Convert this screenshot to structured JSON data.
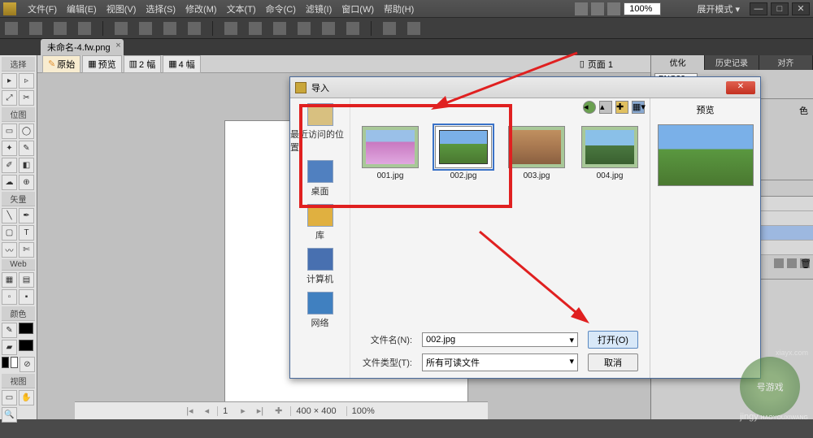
{
  "menubar": {
    "items": [
      "文件(F)",
      "编辑(E)",
      "视图(V)",
      "选择(S)",
      "修改(M)",
      "文本(T)",
      "命令(C)",
      "滤镜(I)",
      "窗口(W)",
      "帮助(H)"
    ],
    "zoom": "100%",
    "mode_label": "展开模式 ▾"
  },
  "doctab": {
    "label": "未命名-4.fw.png",
    "close": "×"
  },
  "subtabs": {
    "items": [
      "原始",
      "预览",
      "2 幅",
      "4 幅"
    ],
    "page_prefix": "页面 1"
  },
  "left_sections": [
    "选择",
    "位图",
    "矢量",
    "Web",
    "颜色",
    "视图"
  ],
  "right_panels": {
    "tabs": [
      "优化",
      "历史记录",
      "对齐"
    ],
    "format": "PNG32",
    "secondary": "色",
    "preview_label": "预览"
  },
  "dialog": {
    "title": "导入",
    "places": [
      "最近访问的位置",
      "桌面",
      "库",
      "计算机",
      "网络"
    ],
    "files": [
      {
        "name": "001.jpg",
        "selected": false,
        "cls": "t1"
      },
      {
        "name": "002.jpg",
        "selected": true,
        "cls": "t2"
      },
      {
        "name": "003.jpg",
        "selected": false,
        "cls": "t3"
      },
      {
        "name": "004.jpg",
        "selected": false,
        "cls": "t4"
      }
    ],
    "filename_label": "文件名(N):",
    "filename_value": "002.jpg",
    "filetype_label": "文件类型(T):",
    "filetype_value": "所有可读文件",
    "open_btn": "打开(O)",
    "cancel_btn": "取消",
    "preview_label": "预览"
  },
  "statusbar": {
    "page": "1",
    "dims": "400 × 400",
    "zoom": "100%"
  },
  "watermark": {
    "main": "号游戏",
    "sub": "jingy",
    "url": "xiayx.com",
    "tag": "HAOYOUXIWANG"
  }
}
